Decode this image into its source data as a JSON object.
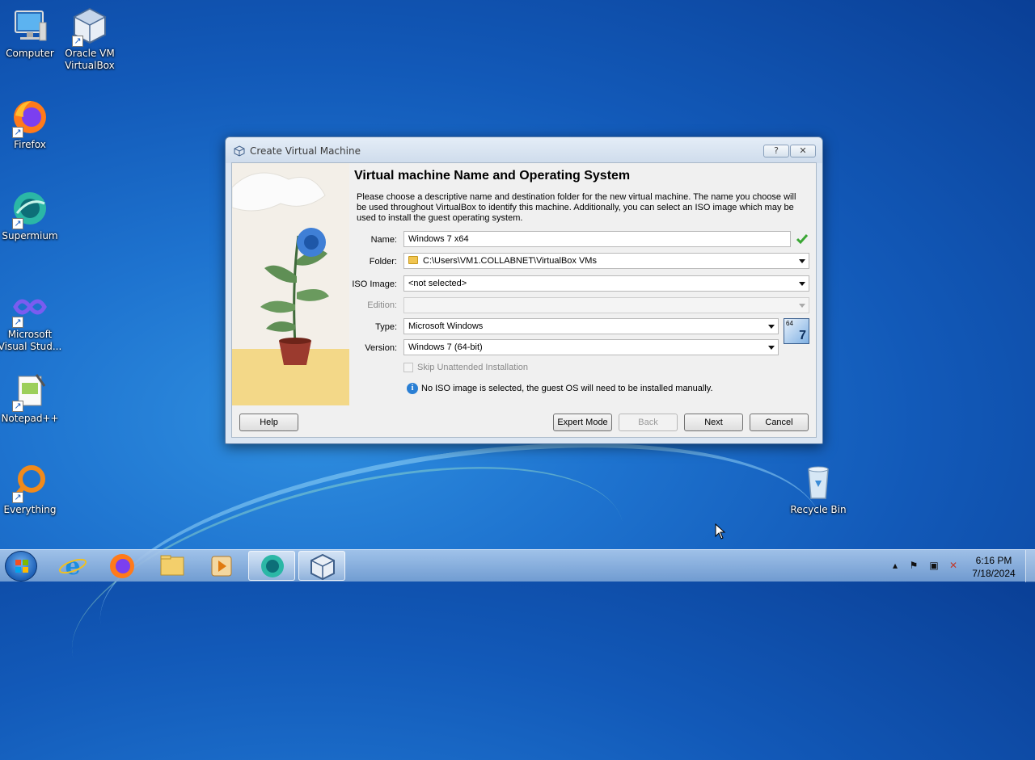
{
  "desktop": {
    "icons": [
      {
        "label": "Computer",
        "icon": "computer-icon"
      },
      {
        "label": "Oracle VM VirtualBox",
        "icon": "virtualbox-icon"
      },
      {
        "label": "Firefox",
        "icon": "firefox-icon"
      },
      {
        "label": "Supermium",
        "icon": "supermium-icon"
      },
      {
        "label": "Microsoft Visual Stud...",
        "icon": "visual-studio-icon"
      },
      {
        "label": "Notepad++",
        "icon": "notepadpp-icon"
      },
      {
        "label": "Everything",
        "icon": "everything-icon"
      },
      {
        "label": "Recycle Bin",
        "icon": "recycle-bin-icon"
      }
    ]
  },
  "dialog": {
    "title": "Create Virtual Machine",
    "help_button": "?",
    "close_button": "✕",
    "heading": "Virtual machine Name and Operating System",
    "description": "Please choose a descriptive name and destination folder for the new virtual machine. The name you choose will be used throughout VirtualBox to identify this machine. Additionally, you can select an ISO image which may be used to install the guest operating system.",
    "fields": {
      "name": {
        "label": "Name:",
        "value": "Windows 7 x64"
      },
      "folder": {
        "label": "Folder:",
        "value": "C:\\Users\\VM1.COLLABNET\\VirtualBox VMs"
      },
      "iso": {
        "label": "ISO Image:",
        "value": "<not selected>"
      },
      "edition": {
        "label": "Edition:",
        "value": ""
      },
      "type": {
        "label": "Type:",
        "value": "Microsoft Windows"
      },
      "version": {
        "label": "Version:",
        "value": "Windows 7 (64-bit)"
      }
    },
    "os_badge": {
      "bits": "64",
      "version": "7"
    },
    "skip_unattended": {
      "label": "Skip Unattended Installation",
      "checked": false,
      "enabled": false
    },
    "info_message": "No ISO image is selected, the guest OS will need to be installed manually.",
    "buttons": {
      "help": "Help",
      "expert_mode": "Expert Mode",
      "back": "Back",
      "next": "Next",
      "cancel": "Cancel"
    }
  },
  "taskbar": {
    "pinned": [
      "start-orb",
      "internet-explorer",
      "firefox",
      "file-explorer",
      "media-player",
      "supermium",
      "virtualbox"
    ],
    "tray": {
      "time": "6:16 PM",
      "date": "7/18/2024"
    }
  },
  "colors": {
    "accent": "#1e73cf",
    "dialog_bg": "#f0f0f0",
    "check_green": "#3aa634",
    "info_blue": "#2a7fd4"
  }
}
